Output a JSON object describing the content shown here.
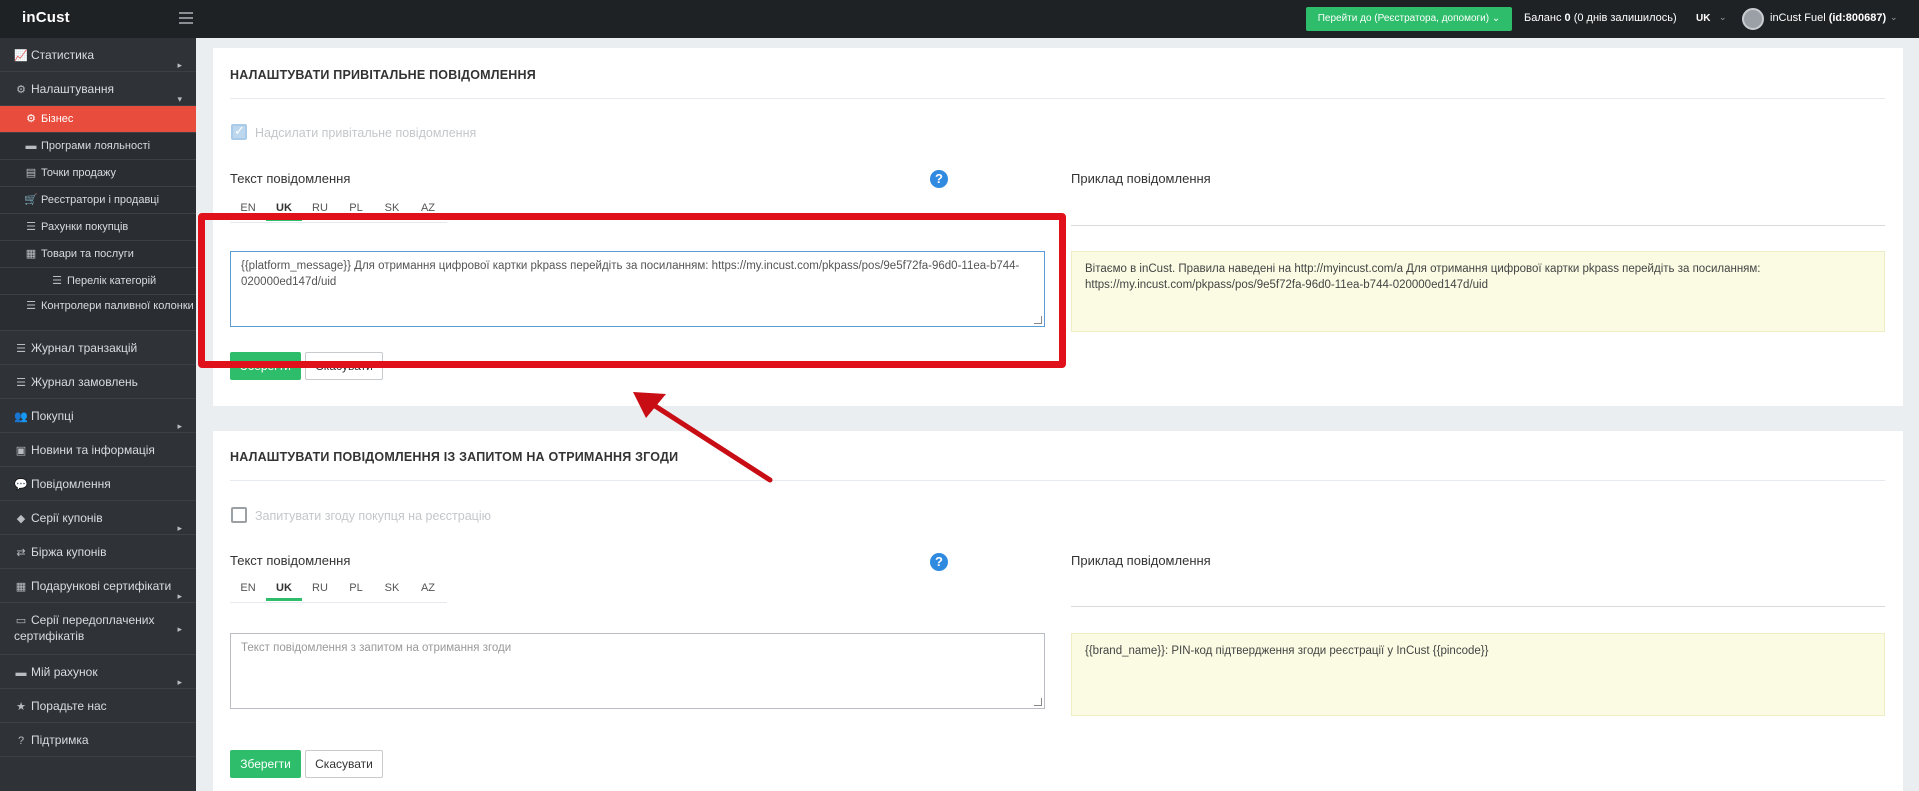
{
  "topbar": {
    "logo": "inCust",
    "goto_label": "Перейти до (Реєстратора, допомоги)",
    "balance_label": "Баланс",
    "balance_value": "0",
    "balance_days": "(0 днів залишилось)",
    "language": "UK",
    "user_name": "inCust Fuel",
    "user_id": "(id:800687)"
  },
  "sidebar": {
    "items": [
      {
        "label": "Статистика",
        "icon": "chart-line-icon",
        "caret": "▸"
      },
      {
        "label": "Налаштування",
        "icon": "gear-icon",
        "caret": "▾"
      },
      {
        "label": "Бізнес",
        "icon": "gear-icon"
      },
      {
        "label": "Програми лояльності",
        "icon": "briefcase-icon"
      },
      {
        "label": "Точки продажу",
        "icon": "document-icon"
      },
      {
        "label": "Реєстратори і продавці",
        "icon": "cart-icon"
      },
      {
        "label": "Рахунки покупців",
        "icon": "list-icon"
      },
      {
        "label": "Товари та послуги",
        "icon": "list-icon"
      },
      {
        "label": "Перелік категорій",
        "icon": "list-icon"
      },
      {
        "label": "Контролери паливної колонки",
        "icon": "list-icon"
      },
      {
        "label": "Журнал транзакцій",
        "icon": "list-icon"
      },
      {
        "label": "Журнал замовлень",
        "icon": "list-icon"
      },
      {
        "label": "Покупці",
        "icon": "users-icon",
        "caret": "▸"
      },
      {
        "label": "Новини та інформація",
        "icon": "newspaper-icon"
      },
      {
        "label": "Повідомлення",
        "icon": "comment-icon"
      },
      {
        "label": "Серії купонів",
        "icon": "tag-icon",
        "caret": "▸"
      },
      {
        "label": "Біржа купонів",
        "icon": "exchange-icon"
      },
      {
        "label": "Подарункові сертифікати",
        "icon": "gift-icon",
        "caret": "▸"
      },
      {
        "label": "Серії передоплачених сертифікатів",
        "icon": "card-icon",
        "caret": "▸"
      },
      {
        "label": "Мій рахунок",
        "icon": "credit-card-icon",
        "caret": "▸"
      },
      {
        "label": "Порадьте нас",
        "icon": "star-icon"
      },
      {
        "label": "Підтримка",
        "icon": "question-circle-icon"
      }
    ]
  },
  "welcome_panel": {
    "title": "НАЛАШТУВАТИ ПРИВІТАЛЬНЕ ПОВІДОМЛЕННЯ",
    "checkbox_label": "Надсилати привітальне повідомлення",
    "checkbox_checked": true,
    "text_label": "Текст повідомлення",
    "example_label": "Приклад повідомлення",
    "tabs": [
      "EN",
      "UK",
      "RU",
      "PL",
      "SK",
      "AZ"
    ],
    "active_tab": "UK",
    "message_value": "{{platform_message}} Для отримання цифрової картки pkpass перейдіть за посиланням: https://my.incust.com/pkpass/pos/9e5f72fa-96d0-11ea-b744-020000ed147d/uid",
    "example_text": "Вітаємо в inCust. Правила наведені на http://myincust.com/a Для отримання цифрової картки pkpass перейдіть за посиланням: https://my.incust.com/pkpass/pos/9e5f72fa-96d0-11ea-b744-020000ed147d/uid",
    "save_label": "Зберегти",
    "cancel_label": "Скасувати"
  },
  "consent_panel": {
    "title": "НАЛАШТУВАТИ ПОВІДОМЛЕННЯ ІЗ ЗАПИТОМ НА ОТРИМАННЯ ЗГОДИ",
    "checkbox_label": "Запитувати згоду покупця на реєстрацію",
    "checkbox_checked": false,
    "text_label": "Текст повідомлення",
    "example_label": "Приклад повідомлення",
    "tabs": [
      "EN",
      "UK",
      "RU",
      "PL",
      "SK",
      "AZ"
    ],
    "active_tab": "UK",
    "message_placeholder": "Текст повідомлення з запитом на отримання згоди",
    "example_text": "{{brand_name}}: PIN-код підтвердження згоди реєстрації у InCust {{pincode}}",
    "save_label": "Зберегти",
    "cancel_label": "Скасувати"
  },
  "colors": {
    "accent_green": "#2ebd6a",
    "active_red": "#e84c3d",
    "annotation_red": "#e0111b",
    "help_blue": "#2f8ae0",
    "example_bg": "#fbfbe3"
  }
}
